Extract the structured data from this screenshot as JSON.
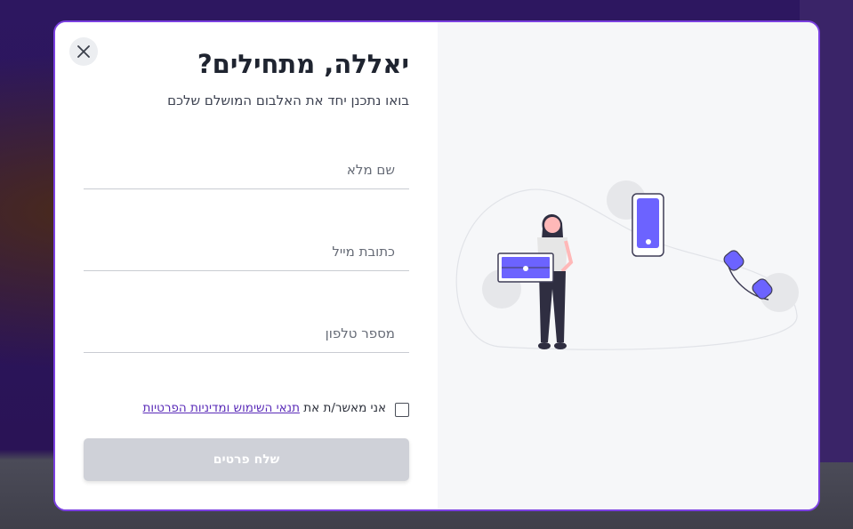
{
  "modal": {
    "close_icon": "close-icon",
    "title": "יאללה, מתחילים?",
    "subtitle": "בואו נתכנן יחד את האלבום המושלם שלכם",
    "fields": {
      "full_name": {
        "placeholder": "שם מלא",
        "value": ""
      },
      "email": {
        "placeholder": "כתובת מייל",
        "value": ""
      },
      "phone": {
        "placeholder": "מספר טלפון",
        "value": ""
      }
    },
    "consent": {
      "checked": false,
      "text": "אני מאשר/ת את",
      "link_text": "תנאי השימוש ומדיניות הפרטיות"
    },
    "submit_label": "שלח פרטים"
  },
  "illustration": {
    "icons": [
      "woman-with-laptop-icon",
      "smartphone-icon",
      "phone-handset-icon"
    ]
  },
  "colors": {
    "accent": "#6c63ff",
    "modal_border": "#7a3fe0",
    "link": "#5a2bb8",
    "button_disabled": "#cfd1d8",
    "backdrop": "#2a1451"
  }
}
